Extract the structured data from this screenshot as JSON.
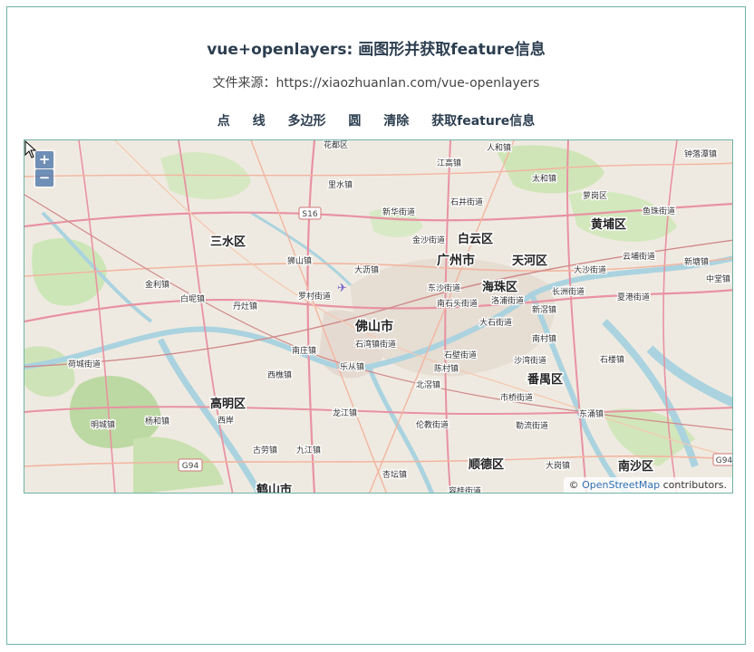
{
  "page": {
    "title": "vue+openlayers: 画图形并获取feature信息",
    "source_label": "文件来源：",
    "source_url": "https://xiaozhuanlan.com/vue-openlayers"
  },
  "toolbar": {
    "point": "点",
    "line": "线",
    "polygon": "多边形",
    "circle": "圆",
    "clear": "清除",
    "get_info": "获取feature信息"
  },
  "map": {
    "zoom_in": "+",
    "zoom_out": "−",
    "attribution_prefix": "©",
    "attribution_link": "OpenStreetMap",
    "attribution_suffix": "contributors.",
    "places": {
      "guangzhou": "广州市",
      "foshan": "佛山市",
      "haizhu": "海珠区",
      "tianhe": "天河区",
      "baiyun": "白云区",
      "huangpu": "黄埔区",
      "sanshui": "三水区",
      "panyu": "番禺区",
      "gaoming": "高明区",
      "shunde": "顺德区",
      "nansha": "南沙区",
      "heshan": "鹤山市",
      "lishui": "里水镇",
      "dali": "大沥镇",
      "shishan": "狮山镇",
      "danzao": "丹灶镇",
      "jiujiang": "九江镇",
      "longjiang": "龙江镇",
      "lunjiao": "伦教街道",
      "beijiao": "北滘镇",
      "leliu": "乐从镇",
      "chencun": "陈村镇",
      "xiqiao": "西樵镇",
      "huadu": "花都区",
      "jianggao": "江高镇",
      "renhe": "人和镇",
      "taihe": "太和镇",
      "zhongluotan": "钟落潭镇",
      "xinhua": "新华街道",
      "shijing": "石井街道",
      "jinsha": "金沙街道",
      "dongsha": "东沙街道",
      "nanshi": "南石头街道",
      "shibi": "石壁街道",
      "dashi": "大石街道",
      "luopu": "洛浦街道",
      "xinjiao": "新滘镇",
      "nancun": "南村镇",
      "shiqi": "市桥街道",
      "shilou": "石楼镇",
      "dagang": "大岗镇",
      "dongyong": "东涌镇",
      "shawan": "沙湾街道",
      "yuzhu": "鱼珠街道",
      "luogang": "萝岗区",
      "dasha": "大沙街道",
      "changzhou": "长洲街道",
      "xianggang": "夏港街道",
      "yunpu": "云埔街道",
      "xintang": "新塘镇",
      "zhongtang": "中堂镇",
      "baijiao": "白坭镇",
      "jinli": "金利镇",
      "luocun": "罗村街道",
      "nanzhuang": "南庄镇",
      "shiwan": "石湾镇街道",
      "xian": "西岸",
      "hecheng": "荷城街道",
      "yanghe": "杨和镇",
      "mingcheng": "明城镇",
      "gulao": "古劳镇",
      "xingtan": "杏坛镇",
      "ronggui": "容桂街道",
      "ligang": "勒流街道",
      "s16": "S16",
      "g94": "G94",
      "g94b": "G94"
    }
  }
}
